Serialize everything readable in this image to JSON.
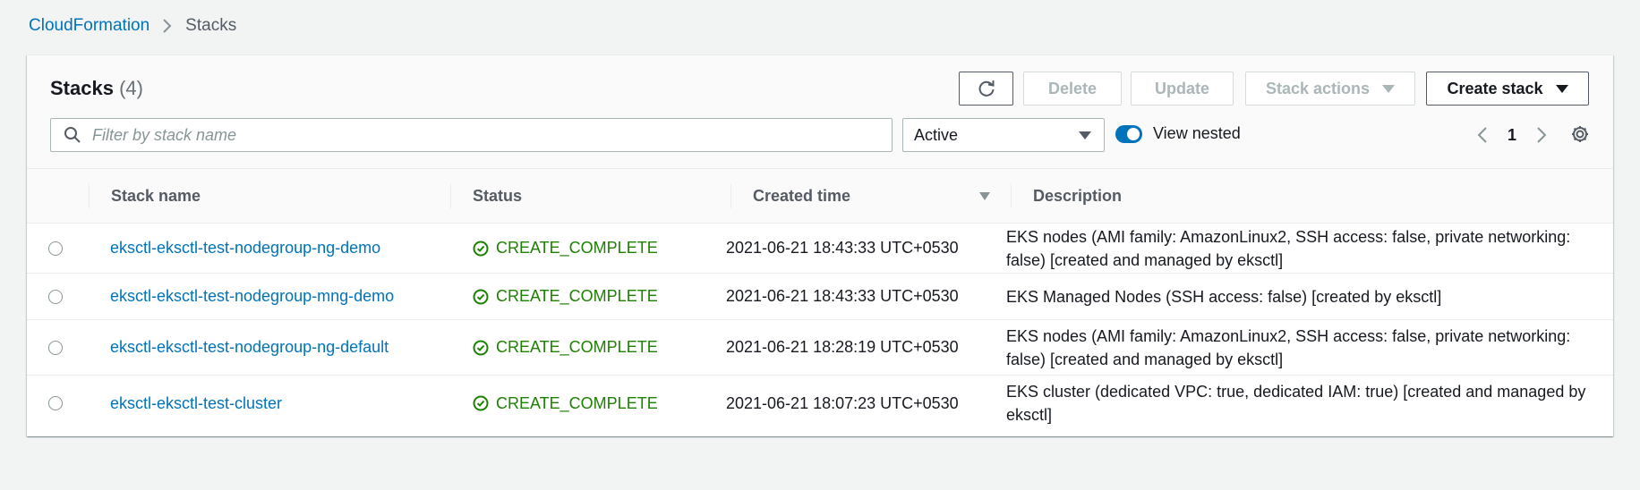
{
  "breadcrumb": {
    "parent": "CloudFormation",
    "current": "Stacks"
  },
  "header": {
    "title": "Stacks",
    "count": "(4)"
  },
  "toolbar": {
    "delete_label": "Delete",
    "update_label": "Update",
    "stack_actions_label": "Stack actions",
    "create_stack_label": "Create stack"
  },
  "filter": {
    "placeholder": "Filter by stack name",
    "status_select": "Active",
    "view_nested_label": "View nested",
    "view_nested_on": true
  },
  "pagination": {
    "page": "1"
  },
  "table": {
    "columns": {
      "name": "Stack name",
      "status": "Status",
      "created": "Created time",
      "description": "Description"
    },
    "rows": [
      {
        "name": "eksctl-eksctl-test-nodegroup-ng-demo",
        "status": "CREATE_COMPLETE",
        "created": "2021-06-21 18:43:33 UTC+0530",
        "description": "EKS nodes (AMI family: AmazonLinux2, SSH access: false, private networking: false) [created and managed by eksctl]"
      },
      {
        "name": "eksctl-eksctl-test-nodegroup-mng-demo",
        "status": "CREATE_COMPLETE",
        "created": "2021-06-21 18:43:33 UTC+0530",
        "description": "EKS Managed Nodes (SSH access: false) [created by eksctl]"
      },
      {
        "name": "eksctl-eksctl-test-nodegroup-ng-default",
        "status": "CREATE_COMPLETE",
        "created": "2021-06-21 18:28:19 UTC+0530",
        "description": "EKS nodes (AMI family: AmazonLinux2, SSH access: false, private networking: false) [created and managed by eksctl]"
      },
      {
        "name": "eksctl-eksctl-test-cluster",
        "status": "CREATE_COMPLETE",
        "created": "2021-06-21 18:07:23 UTC+0530",
        "description": "EKS cluster (dedicated VPC: true, dedicated IAM: true) [created and managed by eksctl]"
      }
    ]
  },
  "colors": {
    "link": "#0073bb",
    "success": "#1d8102",
    "toggle_on": "#0073bb"
  }
}
